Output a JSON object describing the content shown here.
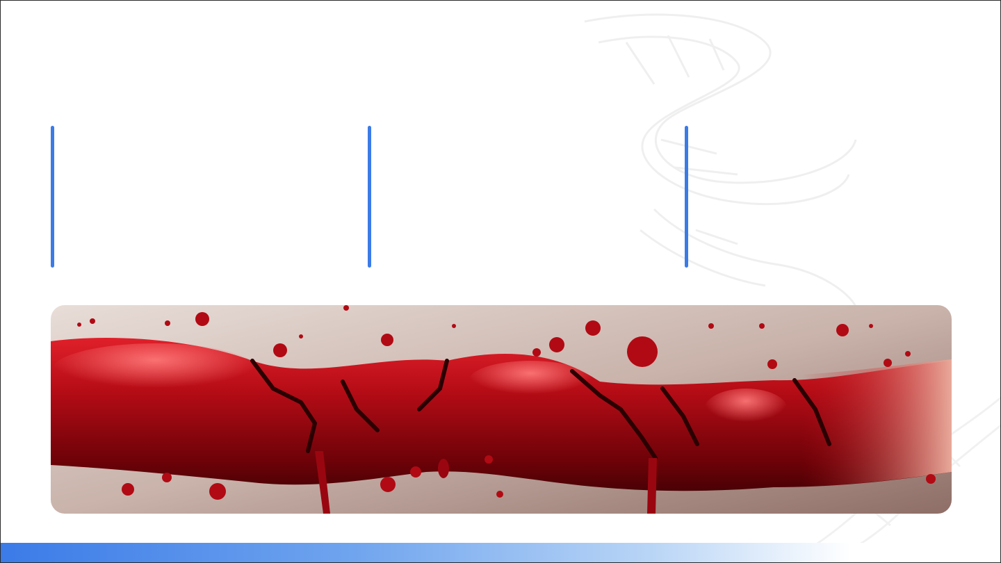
{
  "columns": [
    {
      "text": ""
    },
    {
      "text": ""
    },
    {
      "text": ""
    }
  ],
  "colors": {
    "accent": "#3b7be8",
    "footer_gradient_start": "#3b7be8",
    "footer_gradient_end": "#ffffff",
    "hero_red": "#b0101a"
  },
  "icons": {
    "watermark": "dna-helix-line-art"
  }
}
